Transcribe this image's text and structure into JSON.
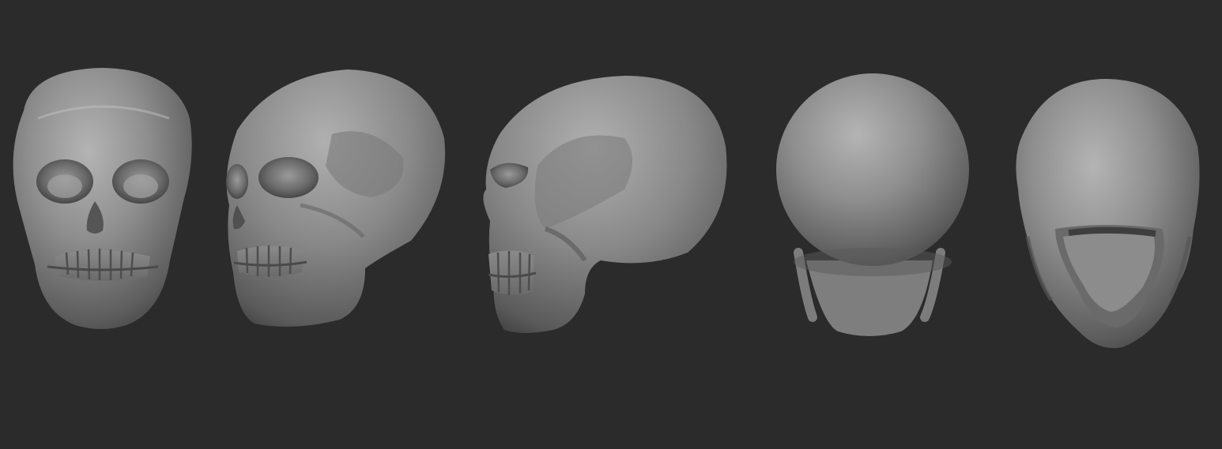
{
  "scene": {
    "background": "#2b2b2b",
    "material": "matcap-gray",
    "views": [
      {
        "name": "front"
      },
      {
        "name": "three-quarter-left"
      },
      {
        "name": "left-side"
      },
      {
        "name": "back"
      },
      {
        "name": "bottom"
      }
    ]
  }
}
